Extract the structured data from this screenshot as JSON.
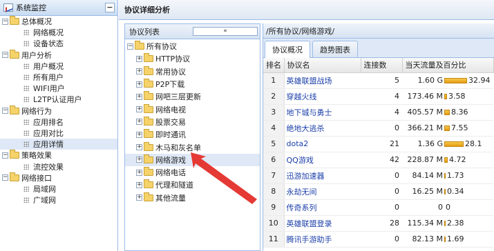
{
  "nav": {
    "title": "系统监控",
    "collapse_label": "−",
    "groups": [
      {
        "label": "总体概况",
        "items": [
          "网络概况",
          "设备状态"
        ]
      },
      {
        "label": "用户分析",
        "items": [
          "用户概况",
          "所有用户",
          "WIFI用户",
          "L2TP认证用户"
        ]
      },
      {
        "label": "网络行为",
        "items": [
          "应用排名",
          "应用对比",
          "应用详情"
        ]
      },
      {
        "label": "策略效果",
        "items": [
          "流控效果"
        ]
      },
      {
        "label": "网络接口",
        "items": [
          "局域网",
          "广域网"
        ]
      }
    ]
  },
  "main": {
    "title": "协议详细分析",
    "protocol_list": {
      "title": "协议列表",
      "collapse_label": "«",
      "root": "所有协议",
      "items": [
        "HTTP协议",
        "常用协议",
        "P2P下载",
        "网吧三层更新",
        "网络电视",
        "股票交易",
        "即时通讯",
        "木马和灰名单",
        "网络游戏",
        "网络电话",
        "代理和隧道",
        "其他流量"
      ]
    },
    "detail": {
      "path": "/所有协议/网络游戏/",
      "tabs": [
        "协议概况",
        "趋势图表"
      ],
      "columns": [
        "排名",
        "协议名",
        "连接数",
        "当天流量及百分比"
      ],
      "rows": [
        {
          "rank": "1",
          "name": "英雄联盟战场",
          "conn": "5",
          "traffic": "1.60 G",
          "pct": "32.94",
          "pct_value": 32.94
        },
        {
          "rank": "2",
          "name": "穿越火线",
          "conn": "4",
          "traffic": "173.46 M",
          "pct": "3.58",
          "pct_value": 3.58
        },
        {
          "rank": "3",
          "name": "地下城与勇士",
          "conn": "4",
          "traffic": "405.57 M",
          "pct": "8.36",
          "pct_value": 8.36
        },
        {
          "rank": "4",
          "name": "绝地大逃杀",
          "conn": "0",
          "traffic": "366.21 M",
          "pct": "7.55",
          "pct_value": 7.55
        },
        {
          "rank": "5",
          "name": "dota2",
          "conn": "21",
          "traffic": "1.36 G",
          "pct": "28.1",
          "pct_value": 28.1
        },
        {
          "rank": "6",
          "name": "QQ游戏",
          "conn": "42",
          "traffic": "228.87 M",
          "pct": "4.72",
          "pct_value": 4.72
        },
        {
          "rank": "7",
          "name": "迅游加速器",
          "conn": "0",
          "traffic": "84.14 M",
          "pct": "1.73",
          "pct_value": 1.73
        },
        {
          "rank": "8",
          "name": "永劫无间",
          "conn": "0",
          "traffic": "16.25 M",
          "pct": "0.34",
          "pct_value": 0.34
        },
        {
          "rank": "9",
          "name": "传奇系列",
          "conn": "0",
          "traffic": "0",
          "pct": "0",
          "pct_value": 0
        },
        {
          "rank": "10",
          "name": "英雄联盟登录",
          "conn": "28",
          "traffic": "115.34 M",
          "pct": "2.38",
          "pct_value": 2.38
        },
        {
          "rank": "11",
          "name": "腾讯手游助手",
          "conn": "0",
          "traffic": "82.13 M",
          "pct": "1.69",
          "pct_value": 1.69
        }
      ]
    }
  },
  "colors": {
    "accent_border": "#99bbe8",
    "bar_fill": "#f2b233",
    "link": "#1a3ea8",
    "arrow": "#e53935"
  }
}
